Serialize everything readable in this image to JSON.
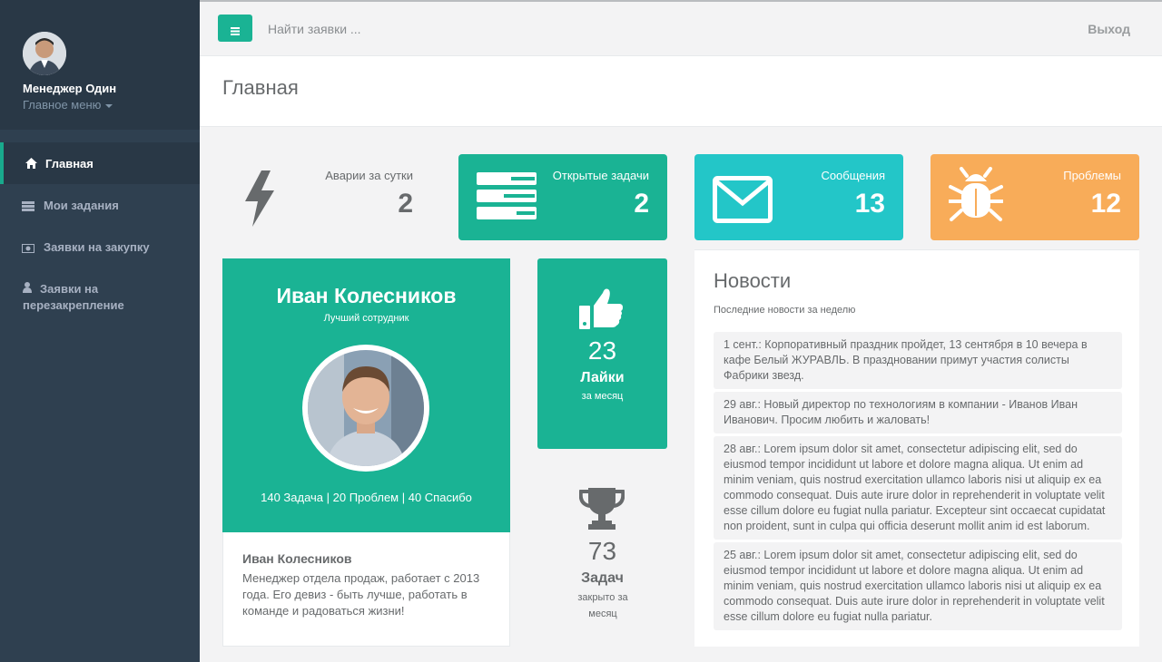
{
  "sidebar": {
    "user_name": "Менеджер Один",
    "menu_label": "Главное меню",
    "items": [
      {
        "label": "Главная",
        "icon": "home-icon"
      },
      {
        "label": "Мои задания",
        "icon": "list-icon"
      },
      {
        "label": "Заявки на закупку",
        "icon": "money-icon"
      },
      {
        "label": "Заявки на",
        "label2": "перезакрепление",
        "icon": "user-icon"
      }
    ]
  },
  "topbar": {
    "search_placeholder": "Найти заявки ...",
    "logout_label": "Выход"
  },
  "page": {
    "title": "Главная"
  },
  "widgets": [
    {
      "label": "Аварии за сутки",
      "value": "2",
      "icon": "bolt-icon"
    },
    {
      "label": "Открытые задачи",
      "value": "2",
      "icon": "tasks-icon",
      "color": "#1ab394"
    },
    {
      "label": "Сообщения",
      "value": "13",
      "icon": "envelope-icon",
      "color": "#23c6c8"
    },
    {
      "label": "Проблемы",
      "value": "12",
      "icon": "bug-icon",
      "color": "#f8ac59"
    }
  ],
  "employee": {
    "name": "Иван Колесников",
    "subtitle": "Лучший сотрудник",
    "stats": "140 Задача | 20 Проблем | 40 Спасибо",
    "desc_name": "Иван Колесников",
    "desc_text": "Менеджер отдела продаж, работает с 2013 года. Его девиз - быть лучше, работать в команде и радоваться жизни!"
  },
  "likes": {
    "value": "23",
    "title": "Лайки",
    "subtitle": "за месяц",
    "icon": "thumbs-up-icon"
  },
  "tasks": {
    "value": "73",
    "title": "Задач",
    "subtitle": "закрыто за месяц",
    "icon": "trophy-icon"
  },
  "news": {
    "title": "Новости",
    "subtitle": "Последние новости за неделю",
    "items": [
      "1 сент.: Корпоративный праздник пройдет, 13 сентября в 10 вечера в кафе Белый ЖУРАВЛЬ. В праздновании примут участия солисты Фабрики звезд.",
      "29 авг.: Новый директор по технологиям в компании - Иванов Иван Иванович. Просим любить и жаловать!",
      "28 авг.: Lorem ipsum dolor sit amet, consectetur adipiscing elit, sed do eiusmod tempor incididunt ut labore et dolore magna aliqua. Ut enim ad minim veniam, quis nostrud exercitation ullamco laboris nisi ut aliquip ex ea commodo consequat. Duis aute irure dolor in reprehenderit in voluptate velit esse cillum dolore eu fugiat nulla pariatur. Excepteur sint occaecat cupidatat non proident, sunt in culpa qui officia deserunt mollit anim id est laborum.",
      "25 авг.: Lorem ipsum dolor sit amet, consectetur adipiscing elit, sed do eiusmod tempor incididunt ut labore et dolore magna aliqua. Ut enim ad minim veniam, quis nostrud exercitation ullamco laboris nisi ut aliquip ex ea commodo consequat. Duis aute irure dolor in reprehenderit in voluptate velit esse cillum dolore eu fugiat nulla pariatur."
    ]
  }
}
